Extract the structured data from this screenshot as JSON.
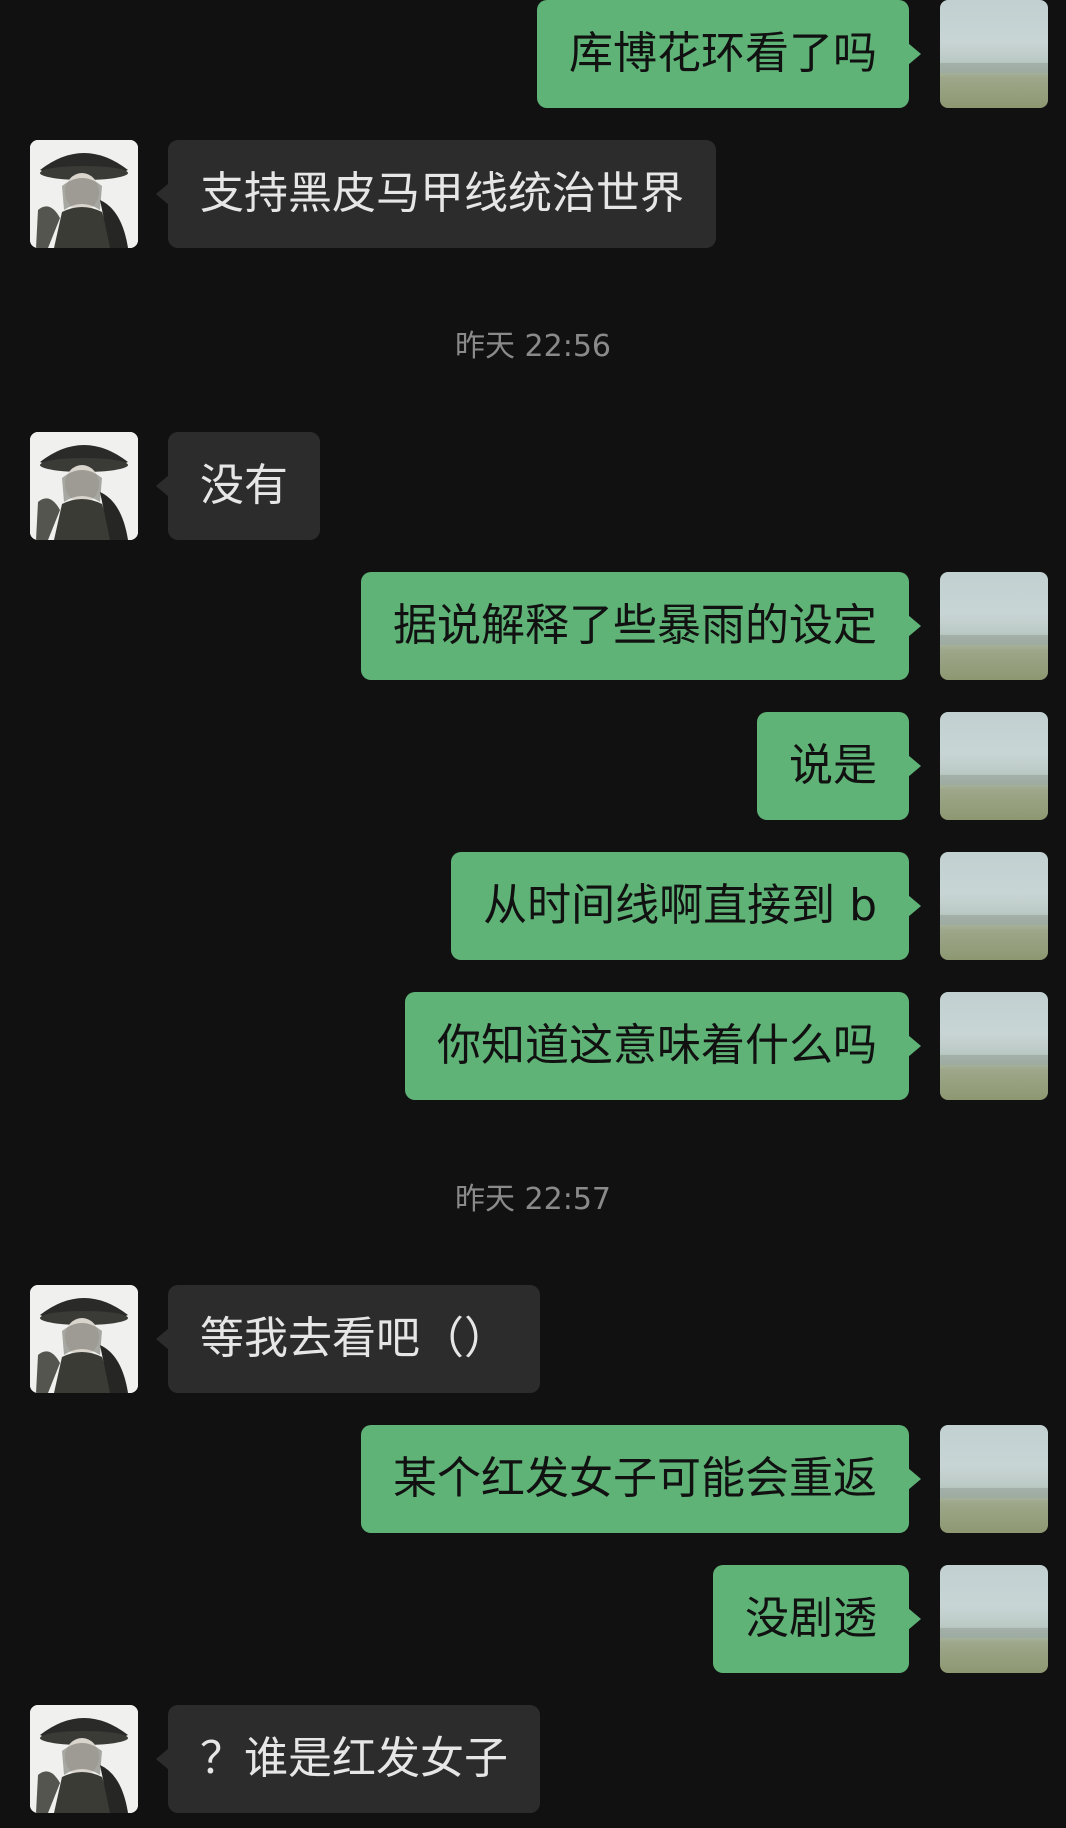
{
  "messages": [
    {
      "from": "me",
      "text": "库博花环看了吗"
    },
    {
      "from": "other",
      "text": "支持黑皮马甲线统治世界"
    },
    {
      "type": "time",
      "text": "昨天 22:56"
    },
    {
      "from": "other",
      "text": "没有"
    },
    {
      "from": "me",
      "text": "据说解释了些暴雨的设定"
    },
    {
      "from": "me",
      "text": "说是"
    },
    {
      "from": "me",
      "text": "从时间线啊直接到 b"
    },
    {
      "from": "me",
      "text": "你知道这意味着什么吗"
    },
    {
      "type": "time",
      "text": "昨天 22:57"
    },
    {
      "from": "other",
      "text": "等我去看吧（）"
    },
    {
      "from": "me",
      "text": "某个红发女子可能会重返"
    },
    {
      "from": "me",
      "text": "没剧透"
    },
    {
      "from": "other",
      "text": "？谁是红发女子"
    }
  ],
  "avatars": {
    "me": "landscape-avatar",
    "other": "anime-witch-avatar"
  },
  "colors": {
    "background": "#111111",
    "outgoing_bubble": "#5fb377",
    "incoming_bubble": "#2c2c2c",
    "timestamp_text": "#8a8a8a"
  }
}
